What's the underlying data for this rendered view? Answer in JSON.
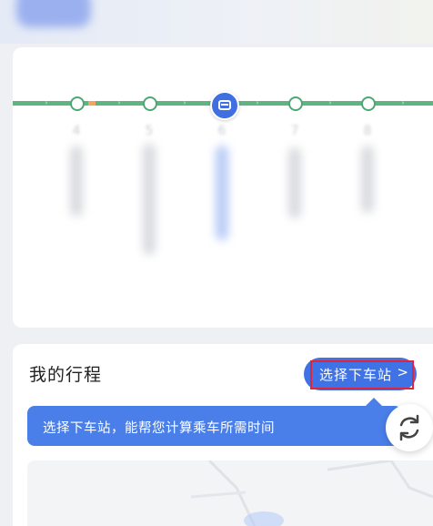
{
  "route": {
    "stop_numbers": [
      "4",
      "5",
      "6",
      "7",
      "8"
    ],
    "current_stop": "6",
    "colors": {
      "line": "#5fb582",
      "bus_badge": "#3f6fe0",
      "highlight": "#f2a55b"
    }
  },
  "trip": {
    "title": "我的行程",
    "select_stop_label": "选择下车站",
    "select_stop_chevron": ">",
    "tip_text": "选择下车站，能帮您计算乘车所需时间"
  },
  "icons": {
    "bus_badge": "bus-icon",
    "refresh": "refresh-icon",
    "chevron": "chevron-right-icon"
  },
  "colors": {
    "accent": "#3f72e4",
    "tip": "#4a7fea",
    "focus_outline": "#e0243a"
  }
}
